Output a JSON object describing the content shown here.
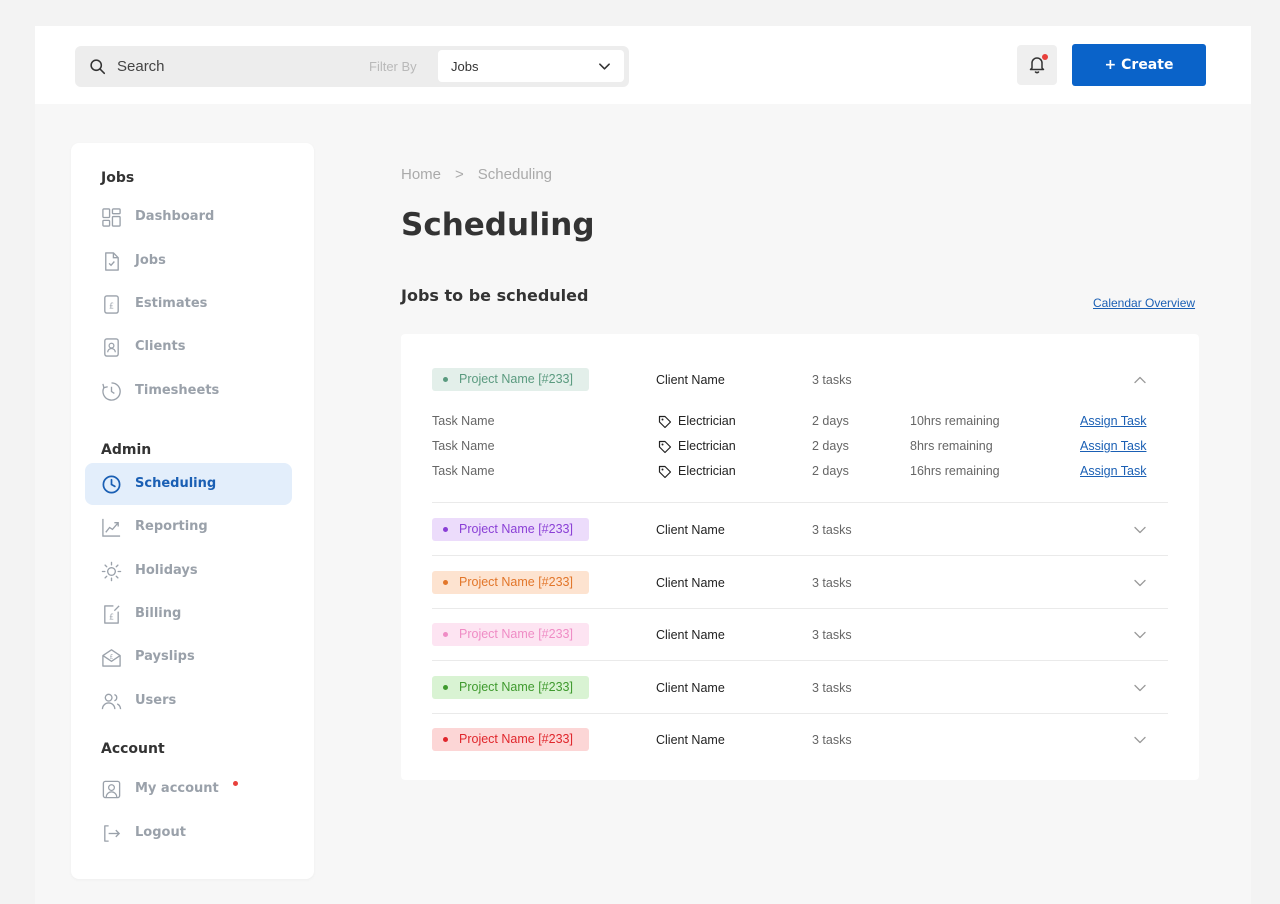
{
  "header": {
    "search_placeholder": "Search",
    "filter_label": "Filter By",
    "filter_value": "Jobs",
    "create_label": "+ Create"
  },
  "sidebar": {
    "sections": [
      {
        "title": "Jobs",
        "items": [
          {
            "label": "Dashboard",
            "icon": "dashboard-icon",
            "active": false
          },
          {
            "label": "Jobs",
            "icon": "document-icon",
            "active": false
          },
          {
            "label": "Estimates",
            "icon": "estimate-icon",
            "active": false
          },
          {
            "label": "Clients",
            "icon": "client-card-icon",
            "active": false
          },
          {
            "label": "Timesheets",
            "icon": "timesheet-icon",
            "active": false
          }
        ]
      },
      {
        "title": "Admin",
        "items": [
          {
            "label": "Scheduling",
            "icon": "clock-icon",
            "active": true
          },
          {
            "label": "Reporting",
            "icon": "chart-icon",
            "active": false
          },
          {
            "label": "Holidays",
            "icon": "sun-icon",
            "active": false
          },
          {
            "label": "Billing",
            "icon": "billing-icon",
            "active": false
          },
          {
            "label": "Payslips",
            "icon": "payslip-icon",
            "active": false
          },
          {
            "label": "Users",
            "icon": "users-icon",
            "active": false
          }
        ]
      },
      {
        "title": "Account",
        "items": [
          {
            "label": "My account",
            "icon": "account-icon",
            "active": false,
            "notification": true
          },
          {
            "label": "Logout",
            "icon": "logout-icon",
            "active": false
          }
        ]
      }
    ]
  },
  "breadcrumb": {
    "home": "Home",
    "separator": ">",
    "current": "Scheduling"
  },
  "page_title": "Scheduling",
  "section_title": "Jobs to be scheduled",
  "calendar_link": "Calendar Overview",
  "projects": [
    {
      "name": "Project Name [#233]",
      "client": "Client Name",
      "tasks": "3 tasks",
      "expanded": true,
      "bg": "#e3efea",
      "fg": "#5a9a7f",
      "task_list": [
        {
          "name": "Task Name",
          "trade": "Electrician",
          "duration": "2 days",
          "remaining": "10hrs remaining",
          "action": "Assign Task"
        },
        {
          "name": "Task Name",
          "trade": "Electrician",
          "duration": "2 days",
          "remaining": "8hrs remaining",
          "action": "Assign Task"
        },
        {
          "name": "Task Name",
          "trade": "Electrician",
          "duration": "2 days",
          "remaining": "16hrs remaining",
          "action": "Assign Task"
        }
      ]
    },
    {
      "name": "Project Name [#233]",
      "client": "Client Name",
      "tasks": "3 tasks",
      "expanded": false,
      "bg": "#ecdcfb",
      "fg": "#8a3fd6"
    },
    {
      "name": "Project Name [#233]",
      "client": "Client Name",
      "tasks": "3 tasks",
      "expanded": false,
      "bg": "#fde3d0",
      "fg": "#e2762a"
    },
    {
      "name": "Project Name [#233]",
      "client": "Client Name",
      "tasks": "3 tasks",
      "expanded": false,
      "bg": "#fde4f2",
      "fg": "#ef8cc5"
    },
    {
      "name": "Project Name [#233]",
      "client": "Client Name",
      "tasks": "3 tasks",
      "expanded": false,
      "bg": "#d9f3d3",
      "fg": "#3f9a2e"
    },
    {
      "name": "Project Name [#233]",
      "client": "Client Name",
      "tasks": "3 tasks",
      "expanded": false,
      "bg": "#fcd6d6",
      "fg": "#e0262c"
    }
  ]
}
